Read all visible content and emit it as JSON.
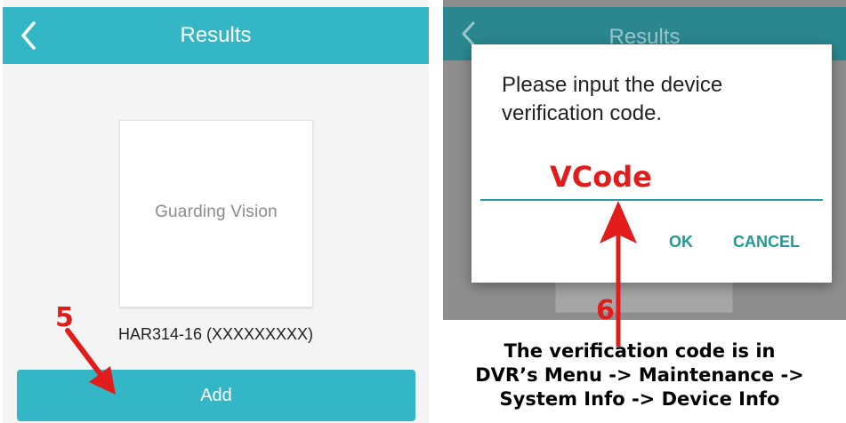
{
  "left": {
    "title": "Results",
    "logo_text": "Guarding Vision",
    "device_name": "HAR314-16 (XXXXXXXXX)",
    "add_label": "Add",
    "step_number": "5"
  },
  "right": {
    "title": "Results",
    "dialog": {
      "message": "Please input the device verification code.",
      "input_annotation": "VCode",
      "ok_label": "OK",
      "cancel_label": "CANCEL"
    },
    "step_number": "6"
  },
  "caption": {
    "line1": "The verification code is in",
    "line2": "DVR’s Menu -> Maintenance ->",
    "line3": "System Info -> Device Info"
  },
  "colors": {
    "teal": "#33b6c6",
    "teal_dim": "#2a8790",
    "annotation_red": "#e21b1b",
    "dialog_button": "#1f9a90"
  },
  "icons": {
    "back": "chevron-left-icon",
    "arrow": "red-arrow-icon"
  }
}
